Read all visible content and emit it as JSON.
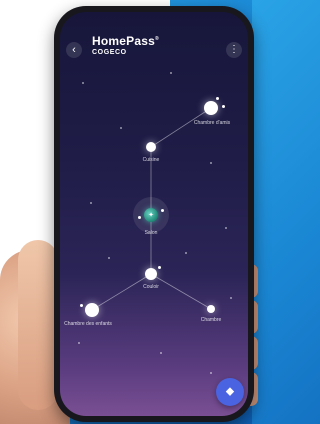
{
  "header": {
    "back_icon": "chevron-left-icon",
    "brand_title": "HomePass",
    "brand_mark": "®",
    "brand_sub": "COGECO",
    "more_icon": "more-vertical-icon"
  },
  "network": {
    "hub_label": "Salon",
    "rooms": [
      {
        "id": "chambre-amis",
        "label": "Chambre d'amis"
      },
      {
        "id": "cuisine",
        "label": "Cuisine"
      },
      {
        "id": "couloir",
        "label": "Couloir"
      },
      {
        "id": "chambre-enfants",
        "label": "Chambre des enfants"
      },
      {
        "id": "chambre",
        "label": "Chambre"
      }
    ]
  },
  "fab": {
    "icon": "layers-icon"
  },
  "colors": {
    "accent": "#4a63e0",
    "hub": "#238c7a",
    "background_top": "#17163a",
    "background_bottom": "#7a4f93"
  }
}
